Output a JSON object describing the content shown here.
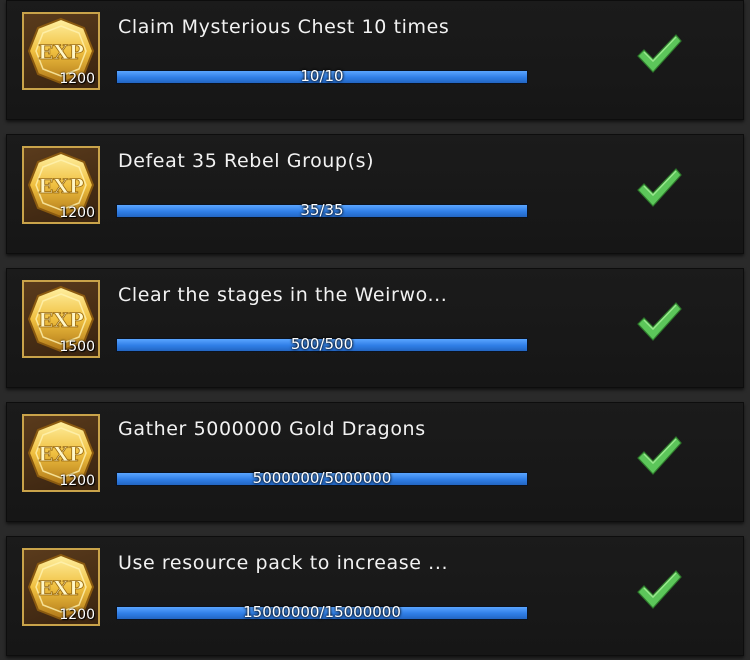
{
  "colors": {
    "panel_bg": "#1b1b1b",
    "frame_gold": "#c9a34a",
    "progress_blue": "#2f7ee6",
    "check_green": "#5cc65a"
  },
  "quests": [
    {
      "title": "Claim Mysterious Chest 10 times",
      "reward_icon": "exp-coin-icon",
      "reward_amount": "1200",
      "progress_text": "10/10",
      "progress_fraction": 1.0,
      "status_icon": "checkmark-icon"
    },
    {
      "title": "Defeat 35 Rebel Group(s)",
      "reward_icon": "exp-coin-icon",
      "reward_amount": "1200",
      "progress_text": "35/35",
      "progress_fraction": 1.0,
      "status_icon": "checkmark-icon"
    },
    {
      "title": "Clear the stages in the Weirwo...",
      "reward_icon": "exp-coin-icon",
      "reward_amount": "1500",
      "progress_text": "500/500",
      "progress_fraction": 1.0,
      "status_icon": "checkmark-icon"
    },
    {
      "title": "Gather 5000000 Gold Dragons",
      "reward_icon": "exp-coin-icon",
      "reward_amount": "1200",
      "progress_text": "5000000/5000000",
      "progress_fraction": 1.0,
      "status_icon": "checkmark-icon"
    },
    {
      "title": "Use resource pack to increase ...",
      "reward_icon": "exp-coin-icon",
      "reward_amount": "1200",
      "progress_text": "15000000/15000000",
      "progress_fraction": 1.0,
      "status_icon": "checkmark-icon"
    }
  ]
}
